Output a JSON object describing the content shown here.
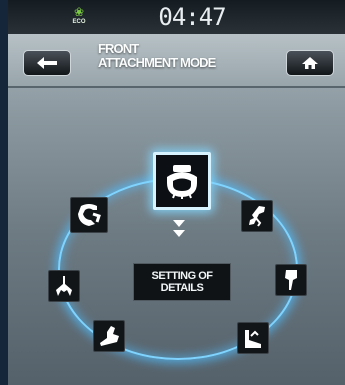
{
  "status": {
    "eco_label": "ECO",
    "clock": "04:47"
  },
  "header": {
    "title_line1": "FRONT",
    "title_line2": "ATTACHMENT MODE"
  },
  "attachments": [
    {
      "name": "bucket",
      "icon": "bucket-icon"
    },
    {
      "name": "grapple",
      "icon": "grapple-icon"
    },
    {
      "name": "crusher",
      "icon": "crusher-icon"
    },
    {
      "name": "breaker",
      "icon": "breaker-icon"
    },
    {
      "name": "sweeper",
      "icon": "sweeper-icon"
    },
    {
      "name": "mulcher",
      "icon": "mulcher-icon"
    },
    {
      "name": "rake",
      "icon": "rake-icon"
    },
    {
      "name": "clamp",
      "icon": "clamp-icon"
    }
  ],
  "details_button": {
    "line1": "SETTING OF",
    "line2": "DETAILS"
  },
  "colors": {
    "ring_glow": "#7fd4ff",
    "eco_leaf": "#7bc843"
  }
}
